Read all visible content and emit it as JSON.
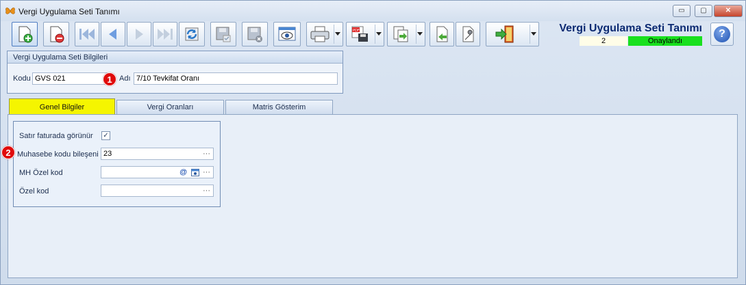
{
  "window": {
    "title": "Vergi Uygulama Seti Tanımı",
    "controls": {
      "minimize": "▭",
      "restore": "▢",
      "close": "✕"
    }
  },
  "toolbar": {
    "buttons": [
      {
        "name": "new-record-button",
        "icon": "new-document-plus-icon"
      },
      {
        "name": "delete-record-button",
        "icon": "document-minus-icon"
      },
      {
        "name": "first-record-button",
        "icon": "skip-first-icon"
      },
      {
        "name": "previous-record-button",
        "icon": "triangle-left-icon"
      },
      {
        "name": "next-record-button",
        "icon": "triangle-right-icon"
      },
      {
        "name": "last-record-button",
        "icon": "skip-last-icon"
      },
      {
        "name": "refresh-button",
        "icon": "refresh-icon"
      },
      {
        "name": "save-button",
        "icon": "floppy-check-icon"
      },
      {
        "name": "save-close-button",
        "icon": "floppy-x-icon"
      },
      {
        "name": "preview-button",
        "icon": "eye-window-icon"
      },
      {
        "name": "print-button",
        "icon": "printer-icon"
      },
      {
        "name": "export-pdf-button",
        "icon": "pdf-save-icon"
      },
      {
        "name": "copy-button",
        "icon": "document-arrow-icon"
      },
      {
        "name": "import-button",
        "icon": "document-back-arrow-icon"
      },
      {
        "name": "tools-button",
        "icon": "wrench-document-icon"
      },
      {
        "name": "exit-button",
        "icon": "exit-door-icon"
      }
    ]
  },
  "header": {
    "form_title": "Vergi Uygulama Seti Tanımı",
    "record_number": "2",
    "status": "Onaylandı",
    "status_color": "#19e01e"
  },
  "info_group": {
    "title": "Vergi Uygulama Seti Bilgileri",
    "code_label": "Kodu",
    "code_value": "GVS 021",
    "name_label": "Adı",
    "name_value": "7/10 Tevkifat Oranı"
  },
  "annotations": {
    "first": "1",
    "second": "2"
  },
  "tabs": [
    {
      "label": "Genel Bilgiler",
      "selected": true
    },
    {
      "label": "Vergi Oranları",
      "selected": false
    },
    {
      "label": "Matris Gösterim",
      "selected": false
    }
  ],
  "general": {
    "show_on_line_label": "Satır faturada görünür",
    "show_on_line_checked": "✓",
    "accounting_label": "Muhasebe kodu bileşeni",
    "accounting_value": "23",
    "mh_code_label": "MH Özel kod",
    "mh_code_value": "",
    "special_code_label": "Özel kod",
    "special_code_value": "",
    "ellipsis": "···",
    "at_symbol": "@"
  }
}
